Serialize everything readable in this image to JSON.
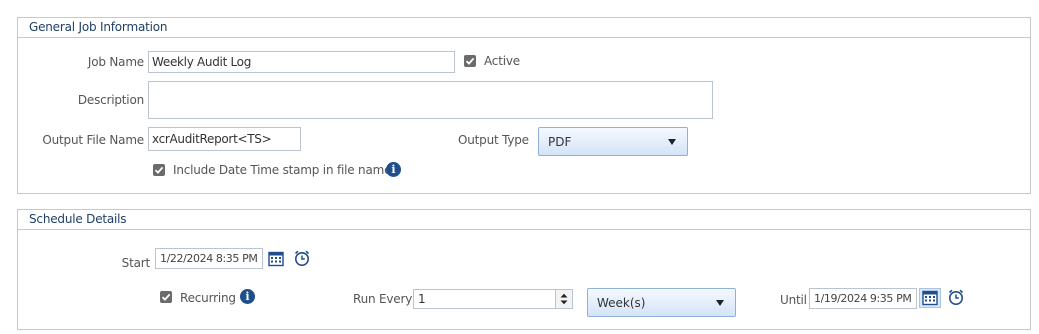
{
  "general": {
    "title": "General Job Information",
    "job_name_label": "Job Name",
    "job_name_value": "Weekly Audit Log",
    "active_label": "Active",
    "active_checked": true,
    "description_label": "Description",
    "description_value": "",
    "output_file_label": "Output File Name",
    "output_file_value": "xcrAuditReport<TS>",
    "output_type_label": "Output Type",
    "output_type_value": "PDF",
    "include_ts_label": "Include Date Time stamp in file name",
    "include_ts_checked": true
  },
  "schedule": {
    "title": "Schedule Details",
    "start_label": "Start",
    "start_value": "1/22/2024 8:35 PM",
    "recurring_label": "Recurring",
    "recurring_checked": true,
    "run_every_label": "Run Every",
    "run_every_value": "1",
    "period_value": "Week(s)",
    "until_label": "Until",
    "until_value": "1/19/2024 9:35 PM"
  },
  "colors": {
    "header_text": "#1f3f66",
    "icon_blue": "#1f4e8c",
    "dropdown_border": "#8fb0d8"
  },
  "icons": [
    "checkbox-checked-icon",
    "info-icon",
    "calendar-icon",
    "clock-icon",
    "spinner-up-icon",
    "spinner-down-icon",
    "chevron-down-icon"
  ]
}
